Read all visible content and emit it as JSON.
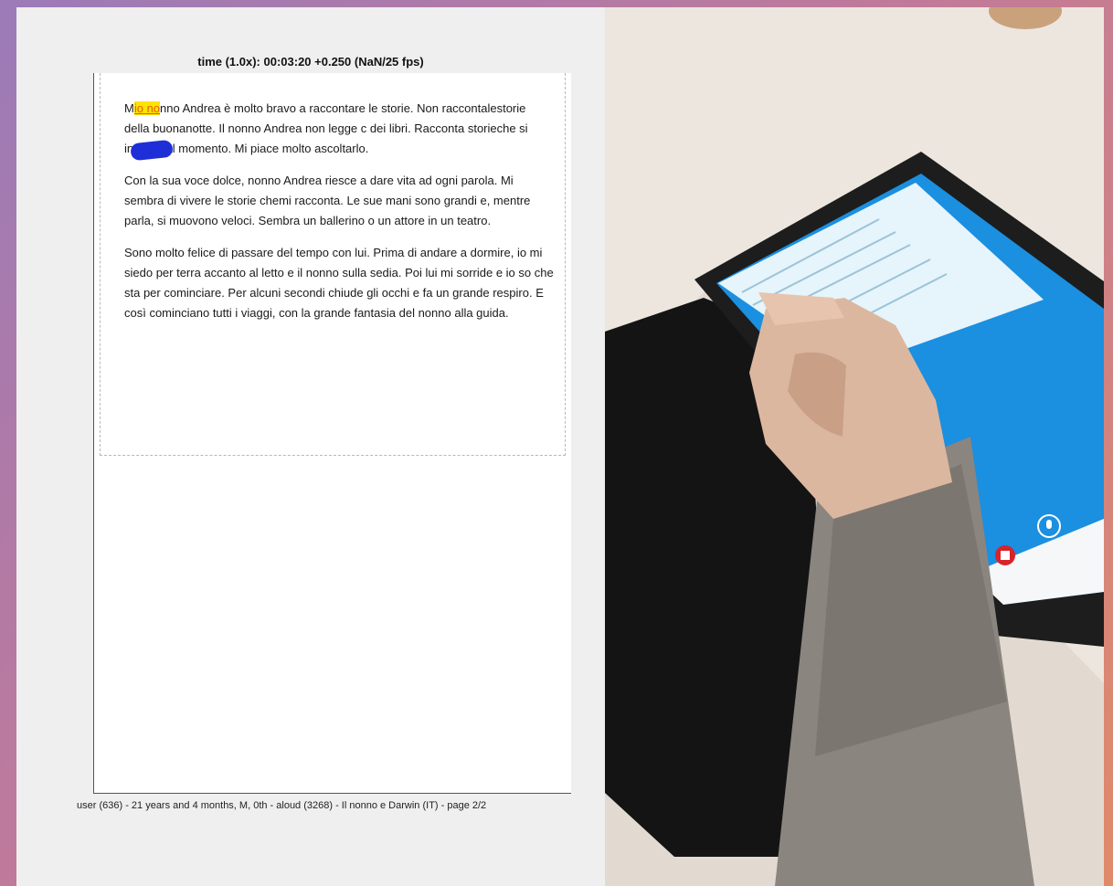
{
  "player": {
    "time_label": "time (1.0x): 00:03:20 +0.250 (NaN/25 fps)"
  },
  "reading": {
    "highlight_before": "M",
    "highlight_word": "io no",
    "p1_rest": "nno Andrea è molto bravo a raccontare le storie. Non raccontalestorie della buonanotte. Il nonno Andrea non legge c        dei libri. Racconta storieche si inventa al momento. Mi piace molto ascoltarlo.",
    "p2": "Con la sua voce dolce, nonno Andrea riesce a dare vita ad ogni parola. Mi sembra di vivere le storie chemi racconta. Le sue mani sono grandi e, mentre parla, si muovono veloci. Sembra un ballerino o un attore in un teatro.",
    "p3": "Sono molto felice di passare del tempo con lui. Prima di andare a dormire, io mi siedo per terra accanto al letto e il nonno sulla sedia. Poi lui mi sorride e io so che sta per cominciare. Per alcuni secondi chiude gli occhi e fa un grande respiro. E così cominciano tutti i viaggi, con la grande fantasia del nonno alla guida."
  },
  "caption": {
    "session_info": "user (636) - 21 years and 4 months, M, 0th - aloud (3268) - Il nonno e Darwin (IT) -  page 2/2"
  },
  "colors": {
    "highlight": "#ffe300",
    "ink": "#1f2fd8",
    "tablet_screen": "#1b8fe0"
  },
  "icons": {
    "tablet_record": "microphone-icon",
    "tablet_stop": "stop-record-icon"
  }
}
